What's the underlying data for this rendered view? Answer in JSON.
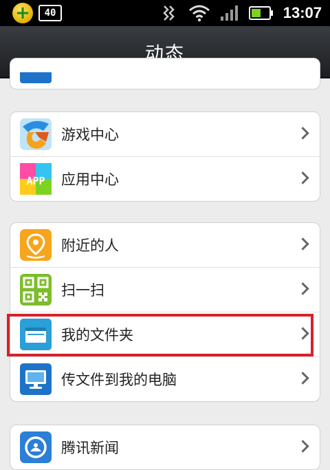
{
  "status_bar": {
    "badge_text": "40",
    "time": "13:07"
  },
  "header": {
    "title": "动态"
  },
  "groups": [
    {
      "items": [
        {
          "label": "游戏中心",
          "icon": "game-center-icon"
        },
        {
          "label": "应用中心",
          "icon": "app-center-icon",
          "icon_text": "APP"
        }
      ]
    },
    {
      "items": [
        {
          "label": "附近的人",
          "icon": "location-pin-icon"
        },
        {
          "label": "扫一扫",
          "icon": "qr-code-icon"
        },
        {
          "label": "我的文件夹",
          "icon": "folder-icon"
        },
        {
          "label": "传文件到我的电脑",
          "icon": "computer-monitor-icon"
        }
      ]
    },
    {
      "items": [
        {
          "label": "腾讯新闻",
          "icon": "tencent-news-icon"
        }
      ]
    }
  ],
  "colors": {
    "highlight": "#d8202a",
    "title_bar": "#2a2c30"
  }
}
